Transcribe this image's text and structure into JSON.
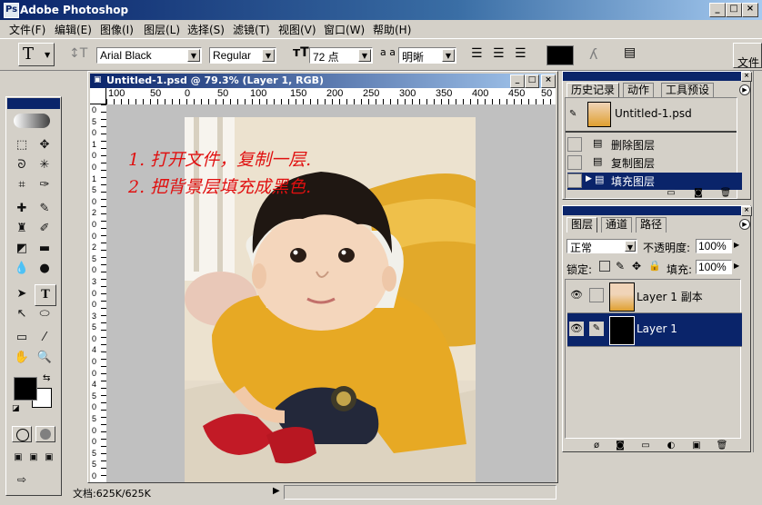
{
  "app": {
    "title": "Adobe Photoshop",
    "logo_glyph": "Ps"
  },
  "menu": [
    "文件(F)",
    "编辑(E)",
    "图像(I)",
    "图层(L)",
    "选择(S)",
    "滤镜(T)",
    "视图(V)",
    "窗口(W)",
    "帮助(H)"
  ],
  "options": {
    "tool_glyph": "T",
    "font_family": "Arial Black",
    "font_style": "Regular",
    "font_size": "72 点",
    "antialias_label": "a a",
    "antialias": "明晰",
    "palette_tab": "文件"
  },
  "document": {
    "title": "Untitled-1.psd @ 79.3% (Layer 1, RGB)"
  },
  "ruler": {
    "h_labels": [
      "100",
      "50",
      "0",
      "50",
      "100",
      "150",
      "200",
      "250",
      "300",
      "350",
      "400",
      "450",
      "50"
    ],
    "v_labels": [
      "0",
      "5",
      "0",
      "1",
      "0",
      "0",
      "1",
      "5",
      "0",
      "2",
      "0",
      "0",
      "2",
      "5",
      "0",
      "3",
      "0",
      "0",
      "3",
      "5",
      "0",
      "4",
      "0",
      "0",
      "4",
      "5",
      "0",
      "5",
      "0",
      "0",
      "5",
      "5",
      "0"
    ]
  },
  "annotations": [
    "1. 打开文件，复制一层.",
    "2. 把背景层填充成黑色."
  ],
  "status": {
    "doc_info": "文档:625K/625K"
  },
  "history": {
    "tabs": [
      "历史记录",
      "动作",
      "工具预设"
    ],
    "snapshot": "Untitled-1.psd",
    "items": [
      "删除图层",
      "复制图层",
      "填充图层"
    ]
  },
  "layers": {
    "tabs": [
      "图层",
      "通道",
      "路径"
    ],
    "blend_mode": "正常",
    "opacity_label": "不透明度:",
    "opacity": "100%",
    "lock_label": "锁定:",
    "fill_label": "填充:",
    "fill": "100%",
    "items": [
      "Layer 1 副本",
      "Layer 1"
    ]
  },
  "colors": {
    "selection": "#0a246a",
    "accent_red": "#e01010",
    "foreground": "#000000",
    "background": "#ffffff"
  }
}
